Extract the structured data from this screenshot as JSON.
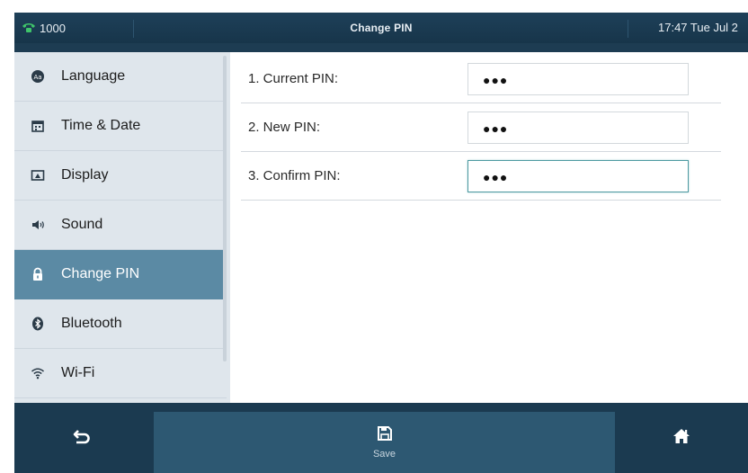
{
  "status_bar": {
    "account": "1000",
    "title": "Change PIN",
    "datetime": "17:47 Tue Jul 2"
  },
  "sidebar": {
    "items": [
      {
        "label": "Language",
        "icon": "language-icon"
      },
      {
        "label": "Time & Date",
        "icon": "calendar-icon"
      },
      {
        "label": "Display",
        "icon": "display-icon"
      },
      {
        "label": "Sound",
        "icon": "speaker-icon"
      },
      {
        "label": "Change PIN",
        "icon": "lock-icon",
        "active": true
      },
      {
        "label": "Bluetooth",
        "icon": "bluetooth-icon"
      },
      {
        "label": "Wi-Fi",
        "icon": "wifi-icon"
      }
    ]
  },
  "form": {
    "rows": [
      {
        "label": "1. Current PIN:",
        "value": "●●●"
      },
      {
        "label": "2. New PIN:",
        "value": "●●●"
      },
      {
        "label": "3. Confirm PIN:",
        "value": "●●●",
        "focused": true
      }
    ]
  },
  "softkeys": {
    "back_icon": "back-arrow-icon",
    "save_label": "Save",
    "save_icon": "save-icon",
    "home_icon": "home-icon"
  },
  "colors": {
    "header_bg": "#1e4059",
    "sidebar_bg": "#dfe6ec",
    "active_item_bg": "#5b8aa4",
    "focus_border": "#4e9aa1",
    "softkey_bg": "#1b3a50",
    "softkey_active_bg": "#2d5872",
    "phone_icon_color": "#3fc46a"
  }
}
